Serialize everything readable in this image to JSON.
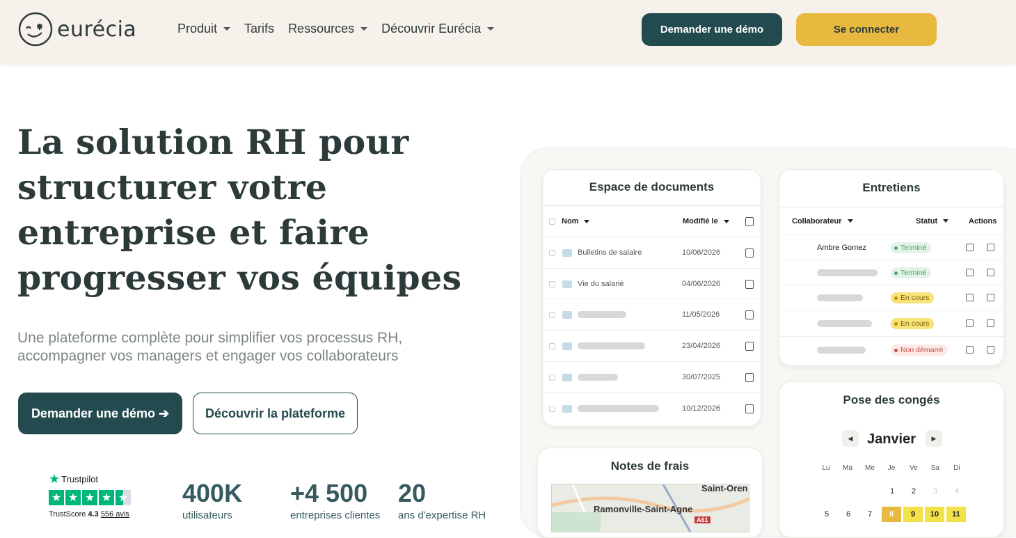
{
  "header": {
    "logo_text": "eurécia",
    "nav": [
      {
        "label": "Produit",
        "caret": true
      },
      {
        "label": "Tarifs",
        "caret": false
      },
      {
        "label": "Ressources",
        "caret": true
      },
      {
        "label": "Découvrir Eurécia",
        "caret": true
      }
    ],
    "demo_button": "Demander une démo",
    "login_button": "Se connecter"
  },
  "hero": {
    "title_lines": [
      "La solution RH pour",
      "structurer votre",
      "entreprise et faire",
      "progresser vos équipes"
    ],
    "subtitle_lines": [
      "Une plateforme complète pour simplifier vos processus RH,",
      "accompagner vos managers et engager vos collaborateurs"
    ],
    "cta_primary": "Demander une démo ➔",
    "cta_secondary": "Découvrir la plateforme"
  },
  "trustpilot": {
    "brand": "Trustpilot",
    "score_label": "TrustScore",
    "score": "4.3",
    "reviews": "556 avis"
  },
  "stats": [
    {
      "value": "400K",
      "label": "utilisateurs"
    },
    {
      "value": "+4 500",
      "label": "entreprises clientes"
    },
    {
      "value": "20",
      "label": "ans d'expertise RH"
    }
  ],
  "documents": {
    "title": "Espace de documents",
    "col_name": "Nom",
    "col_date": "Modifié le",
    "rows": [
      {
        "name": "Bulletins de salaire",
        "date": "10/06/2026"
      },
      {
        "name": "Vie du salarié",
        "date": "04/06/2026"
      },
      {
        "name": "",
        "date": "11/05/2026"
      },
      {
        "name": "",
        "date": "23/04/2026"
      },
      {
        "name": "",
        "date": "30/07/2025"
      },
      {
        "name": "",
        "date": "10/12/2026"
      }
    ]
  },
  "entretiens": {
    "title": "Entretiens",
    "col_collab": "Collaborateur",
    "col_status": "Statut",
    "col_actions": "Actions",
    "rows": [
      {
        "name": "Ambre Gomez",
        "status": "Terminé",
        "kind": "done"
      },
      {
        "name": "",
        "status": "Terminé",
        "kind": "done"
      },
      {
        "name": "",
        "status": "En cours",
        "kind": "prog"
      },
      {
        "name": "",
        "status": "En cours",
        "kind": "prog"
      },
      {
        "name": "",
        "status": "Non démarré",
        "kind": "none"
      }
    ]
  },
  "notes": {
    "title": "Notes de frais",
    "map_label_1": "Ramonville-Saint-Agne",
    "map_label_2": "Saint-Oren",
    "map_road": "A61"
  },
  "conges": {
    "title": "Pose des congés",
    "month": "Janvier",
    "weekdays": [
      "Lu",
      "Ma",
      "Me",
      "Je",
      "Ve",
      "Sa",
      "Di"
    ],
    "week1": [
      "",
      "",
      "",
      "1",
      "2",
      "3",
      "4"
    ],
    "week2": [
      "5",
      "6",
      "7",
      "8",
      "9",
      "10",
      "11"
    ]
  },
  "colors": {
    "primary": "#234a4e",
    "accent": "#e8b93f",
    "header_bg": "#f6f1ea"
  }
}
